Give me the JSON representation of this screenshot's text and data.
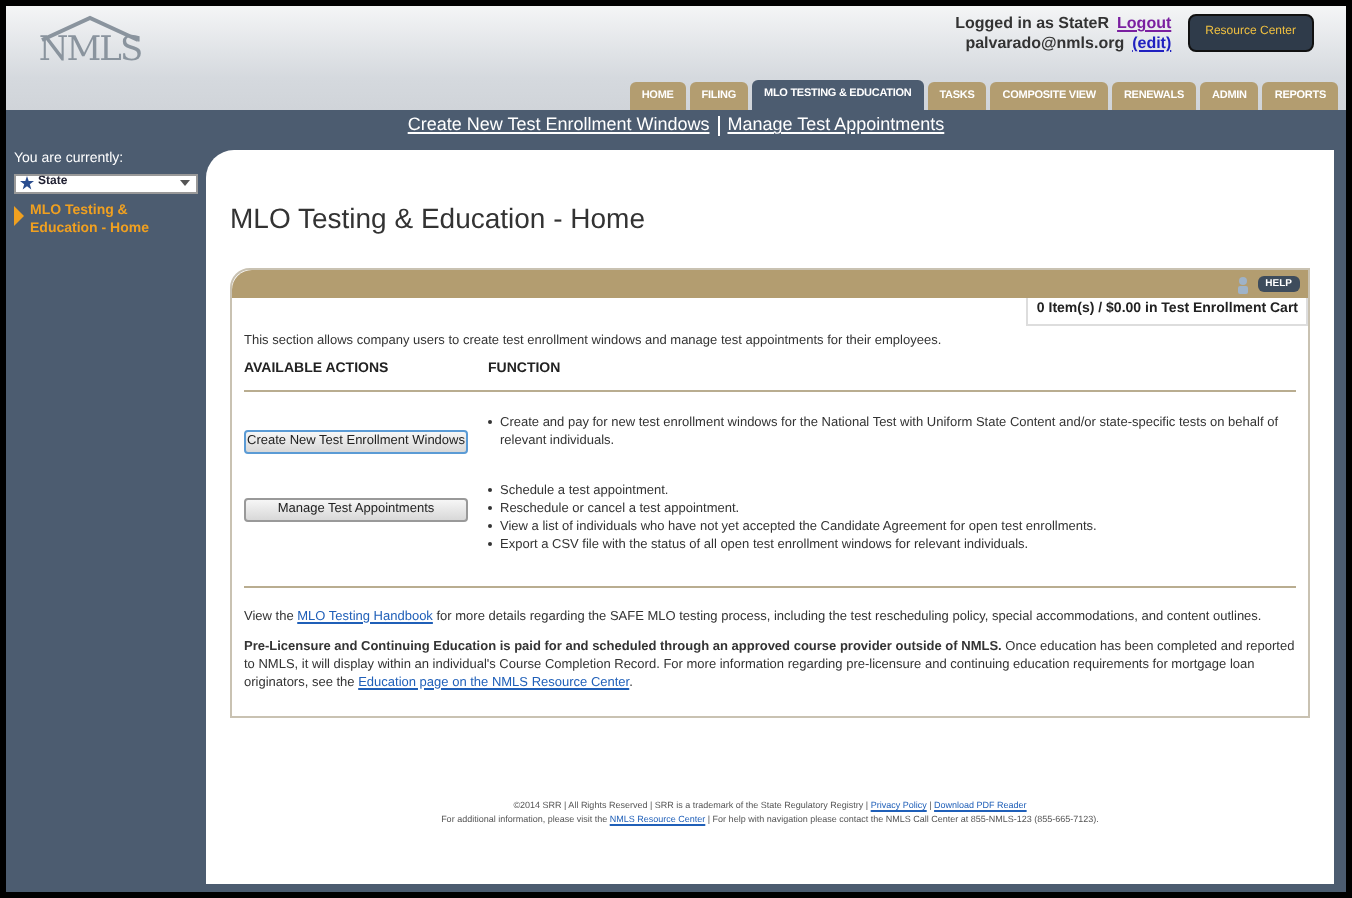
{
  "header": {
    "logo": "NMLS",
    "login_text": "Logged in as StateR",
    "logout": "Logout",
    "email": "palvarado@nmls.org",
    "edit": "(edit)",
    "resource_button": "Resource Center"
  },
  "tabs": [
    {
      "label": "HOME",
      "selected": false
    },
    {
      "label": "FILING",
      "selected": false
    },
    {
      "label": "MLO TESTING & EDUCATION",
      "selected": true
    },
    {
      "label": "TASKS",
      "selected": false
    },
    {
      "label": "COMPOSITE VIEW",
      "selected": false
    },
    {
      "label": "RENEWALS",
      "selected": false
    },
    {
      "label": "ADMIN",
      "selected": false
    },
    {
      "label": "REPORTS",
      "selected": false
    }
  ],
  "subnav": [
    "Create New Test Enrollment Windows",
    "Manage Test Appointments"
  ],
  "sidebar": {
    "label": "You are currently:",
    "role": "State",
    "items": [
      {
        "label": "MLO Testing & Education - Home",
        "selected": true
      }
    ]
  },
  "page_title": "MLO Testing & Education - Home",
  "help_button": "HELP",
  "cart": "0 Item(s) / $0.00 in Test Enrollment Cart",
  "intro": "This section allows company users to create test enrollment windows and manage test appointments for their employees.",
  "columns": [
    "AVAILABLE ACTIONS",
    "FUNCTION"
  ],
  "actions": [
    {
      "button": "Create New Test Enrollment Windows",
      "focused": true,
      "functions": [
        "Create and pay for new test enrollment windows for the National Test with Uniform State Content and/or state-specific tests on behalf of relevant individuals."
      ]
    },
    {
      "button": "Manage Test Appointments",
      "focused": false,
      "functions": [
        "Schedule a test appointment.",
        "Reschedule or cancel a test appointment.",
        "View a list of individuals who have not yet accepted the Candidate Agreement for open test enrollments.",
        "Export a CSV file with the status of all open test enrollment windows for relevant individuals."
      ]
    }
  ],
  "notes": [
    {
      "before": "View the ",
      "link": "MLO Testing Handbook",
      "after": " for more details regarding the SAFE MLO testing process, including the test rescheduling policy, special accommodations, and content outlines."
    },
    {
      "before": "**Pre-Licensure and Continuing Education is paid for and scheduled through an approved course provider outside of NMLS.** Once education has been completed and reported to NMLS, it will display within an individual's Course Completion Record. For more information regarding pre-licensure and continuing education requirements for mortgage loan originators, see the ",
      "link": "Education page on the NMLS Resource Center",
      "after": "."
    }
  ],
  "footer": [
    [
      {
        "kind": "text",
        "text": "©2014 SRR | All Rights Reserved | SRR is a trademark of the State Regulatory Registry | "
      },
      {
        "kind": "link",
        "text": "Privacy Policy"
      },
      {
        "kind": "text",
        "text": " | "
      },
      {
        "kind": "link",
        "text": "Download PDF Reader"
      }
    ],
    [
      {
        "kind": "text",
        "text": "For additional information, please visit the "
      },
      {
        "kind": "link",
        "text": "NMLS Resource Center"
      },
      {
        "kind": "text",
        "text": " | For help with navigation please contact the NMLS Call Center at 855-NMLS-123 (855-665-7123)."
      }
    ]
  ]
}
